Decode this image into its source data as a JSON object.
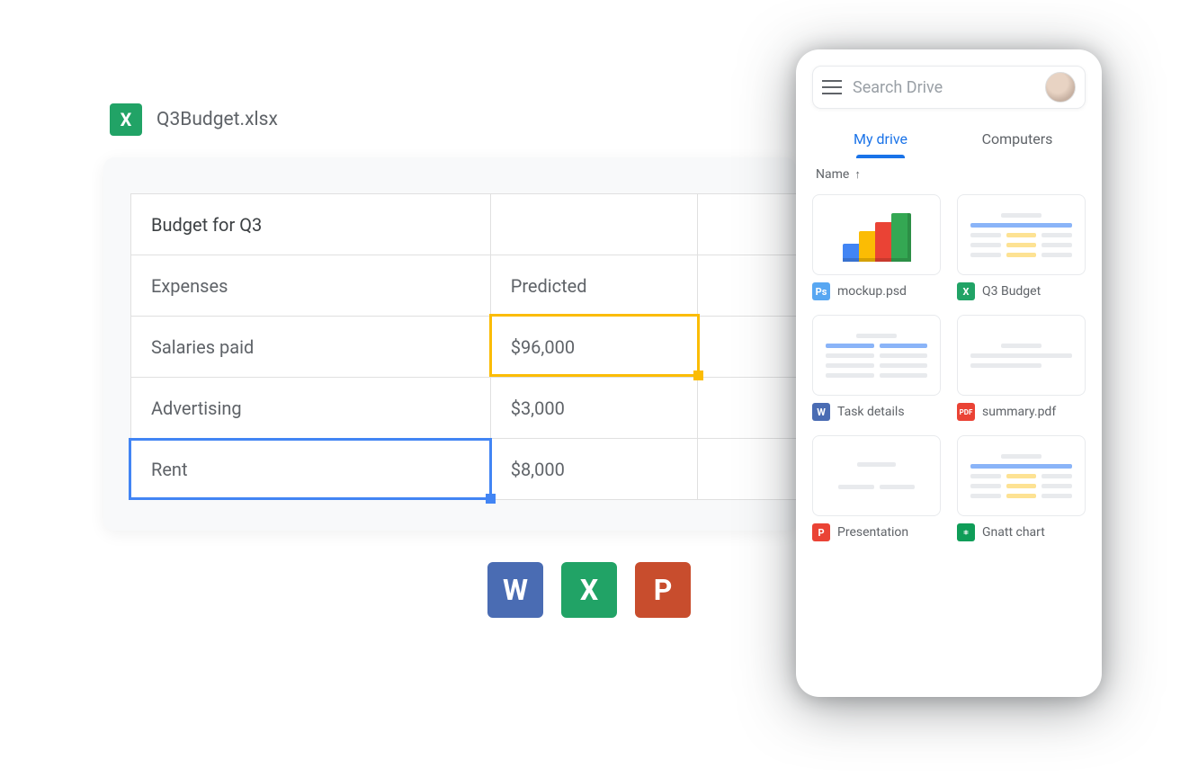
{
  "file": {
    "icon_letter": "X",
    "name": "Q3Budget.xlsx"
  },
  "sheet": {
    "rows": [
      [
        "Budget for Q3",
        "",
        ""
      ],
      [
        "Expenses",
        "Predicted",
        ""
      ],
      [
        "Salaries paid",
        "$96,000",
        ""
      ],
      [
        "Advertising",
        "$3,000",
        ""
      ],
      [
        "Rent",
        "$8,000",
        ""
      ]
    ]
  },
  "filetypes": {
    "word": "W",
    "excel": "X",
    "powerpoint": "P"
  },
  "drive": {
    "search_placeholder": "Search Drive",
    "tabs": {
      "my_drive": "My drive",
      "computers": "Computers"
    },
    "sort": {
      "label": "Name",
      "direction_icon": "↑"
    },
    "files": [
      {
        "icon": "Ps",
        "name": "mockup.psd"
      },
      {
        "icon": "X",
        "name": "Q3 Budget"
      },
      {
        "icon": "W",
        "name": "Task details"
      },
      {
        "icon": "PDF",
        "name": "summary.pdf"
      },
      {
        "icon": "P",
        "name": "Presentation"
      },
      {
        "icon": "▦",
        "name": "Gnatt chart"
      }
    ]
  }
}
